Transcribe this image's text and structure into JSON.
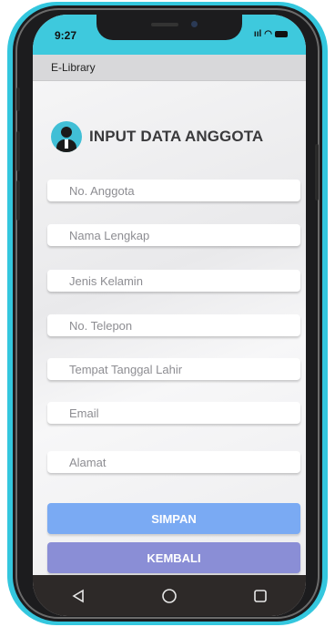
{
  "status_bar": {
    "time": "9:27",
    "signal": "ııl",
    "wifi": "◠"
  },
  "app_bar": {
    "title": "E-Library"
  },
  "header": {
    "title": "INPUT DATA ANGGOTA",
    "icon": "user-avatar-icon"
  },
  "form": {
    "fields": [
      {
        "placeholder": "No. Anggota",
        "value": ""
      },
      {
        "placeholder": "Nama Lengkap",
        "value": ""
      },
      {
        "placeholder": "Jenis Kelamin",
        "value": ""
      },
      {
        "placeholder": "No. Telepon",
        "value": ""
      },
      {
        "placeholder": "Tempat Tanggal Lahir",
        "value": ""
      },
      {
        "placeholder": "Email",
        "value": ""
      },
      {
        "placeholder": "Alamat",
        "value": ""
      }
    ]
  },
  "buttons": {
    "save": "SIMPAN",
    "back": "KEMBALI"
  },
  "nav": {
    "back_icon": "triangle-back-icon",
    "home_icon": "circle-home-icon",
    "recent_icon": "square-recents-icon"
  },
  "colors": {
    "frame": "#34c7de",
    "status_bar": "#3ec9dd",
    "save_button": "#7aaaf3",
    "back_button": "#8a8ed6",
    "nav_bar": "#2d2928"
  }
}
